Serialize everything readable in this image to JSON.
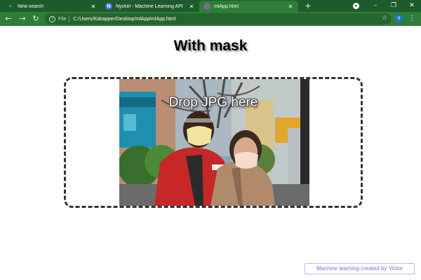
{
  "browser": {
    "tabs": [
      {
        "title": "New search",
        "icon": "search-favicon"
      },
      {
        "title": "Nyckel - Machine Learning API",
        "icon": "nyckel-favicon",
        "badge": "N"
      },
      {
        "title": "mlApp.html",
        "icon": "globe-favicon",
        "active": true
      }
    ],
    "new_tab": "+",
    "window_controls": {
      "minimize": "–",
      "restore": "❐",
      "close": "✕"
    },
    "toolbar": {
      "back": "←",
      "forward": "→",
      "reload": "↻",
      "info": "i",
      "scheme_label": "File",
      "url": "C:/Users/Kidrapper/Desktop/mlApp/mlApp.html",
      "star": "☆",
      "extension_badge": "0",
      "menu": "⋮"
    }
  },
  "page": {
    "title": "With mask",
    "dropzone": {
      "label": "Drop JPG here",
      "image_alt": "Two people wearing face masks on a city street",
      "border_color": "#333333"
    },
    "credit": "Machine learning created by Victor"
  },
  "colors": {
    "tabbar": "#1e5b2c",
    "toolbar": "#2e7d38",
    "credit_text": "#6e70d6",
    "credit_border": "#b9b9ee"
  }
}
